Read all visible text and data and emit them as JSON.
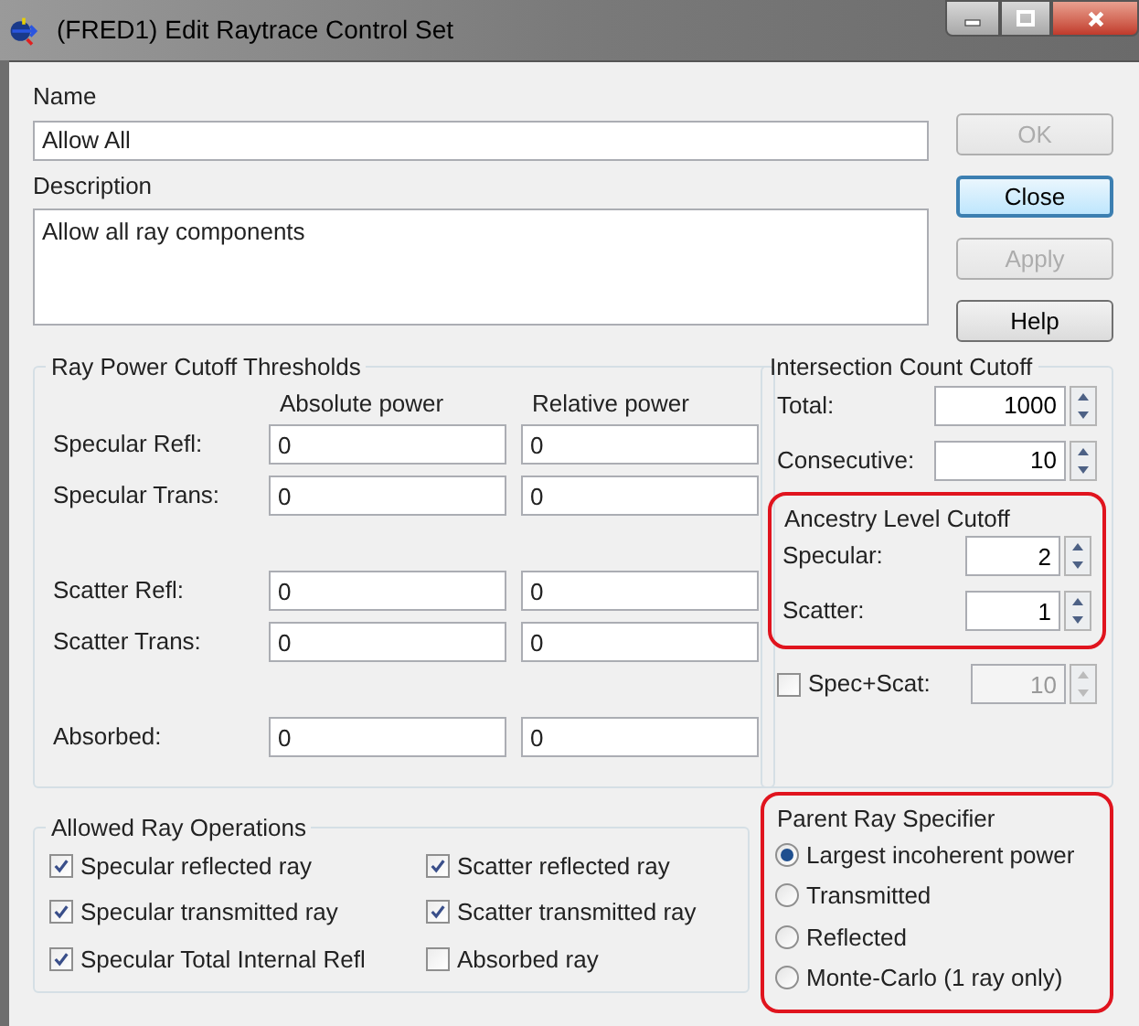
{
  "window": {
    "title": "(FRED1) Edit Raytrace Control Set"
  },
  "name": {
    "label": "Name",
    "value": "Allow All"
  },
  "description": {
    "label": "Description",
    "value": "Allow all ray components"
  },
  "buttons": [
    {
      "label": "OK",
      "disabled": true,
      "default": false
    },
    {
      "label": "Close",
      "disabled": false,
      "default": true
    },
    {
      "label": "Apply",
      "disabled": true,
      "default": false
    },
    {
      "label": "Help",
      "disabled": false,
      "default": false
    }
  ],
  "ray_power": {
    "title": "Ray Power Cutoff Thresholds",
    "columns": [
      "Absolute power",
      "Relative power"
    ],
    "row_groups": [
      [
        {
          "label": "Specular Refl:",
          "values": [
            "0",
            "0"
          ]
        },
        {
          "label": "Specular Trans:",
          "values": [
            "0",
            "0"
          ]
        }
      ],
      [
        {
          "label": "Scatter Refl:",
          "values": [
            "0",
            "0"
          ]
        },
        {
          "label": "Scatter Trans:",
          "values": [
            "0",
            "0"
          ]
        }
      ],
      [
        {
          "label": "Absorbed:",
          "values": [
            "0",
            "0"
          ]
        }
      ]
    ]
  },
  "intersection": {
    "title": "Intersection Count Cutoff",
    "fields": [
      {
        "label": "Total:",
        "value": "1000"
      },
      {
        "label": "Consecutive:",
        "value": "10"
      }
    ]
  },
  "ancestry": {
    "title": "Ancestry Level Cutoff",
    "highlighted": true,
    "fields": [
      {
        "label": "Specular:",
        "value": "2"
      },
      {
        "label": "Scatter:",
        "value": "1"
      }
    ]
  },
  "spec_scat": {
    "label": "Spec+Scat:",
    "checked": false,
    "value": "10"
  },
  "operations": {
    "title": "Allowed Ray Operations",
    "items": [
      {
        "label": "Specular reflected ray",
        "checked": true
      },
      {
        "label": "Scatter reflected ray",
        "checked": true
      },
      {
        "label": "Specular transmitted ray",
        "checked": true
      },
      {
        "label": "Scatter transmitted ray",
        "checked": true
      },
      {
        "label": "Specular Total Internal Refl",
        "checked": true
      },
      {
        "label": "Absorbed ray",
        "checked": false
      }
    ]
  },
  "parent_ray": {
    "title": "Parent Ray Specifier",
    "highlighted": true,
    "options": [
      {
        "label": "Largest incoherent power",
        "selected": true
      },
      {
        "label": "Transmitted",
        "selected": false
      },
      {
        "label": "Reflected",
        "selected": false
      },
      {
        "label": "Monte-Carlo (1 ray only)",
        "selected": false
      }
    ]
  }
}
